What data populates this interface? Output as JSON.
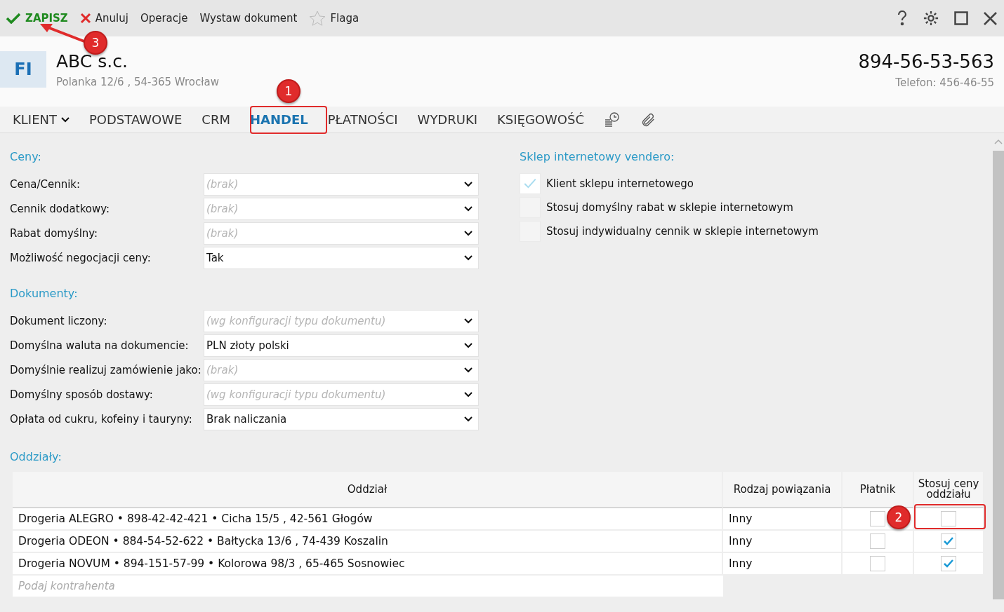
{
  "toolbar": {
    "actions": [
      {
        "kind": "save",
        "label": "ZAPISZ"
      },
      {
        "kind": "cancel",
        "label": "Anuluj"
      },
      {
        "kind": "plain",
        "label": "Operacje"
      },
      {
        "kind": "plain",
        "label": "Wystaw dokument"
      },
      {
        "kind": "flag",
        "label": "Flaga"
      }
    ]
  },
  "header": {
    "avatar": "FI",
    "name": "ABC s.c.",
    "address": "Polanka  12/6 , 54-365 Wrocław",
    "tax_id": "894-56-53-563",
    "phone": "Telefon: 456-46-55"
  },
  "tabs": [
    {
      "label": "KLIENT",
      "kind": "menu",
      "selected": false
    },
    {
      "label": "PODSTAWOWE",
      "kind": "text",
      "selected": false
    },
    {
      "label": "CRM",
      "kind": "text",
      "selected": false
    },
    {
      "label": "HANDEL",
      "kind": "text",
      "selected": true
    },
    {
      "label": "PŁATNOŚCI",
      "kind": "text",
      "selected": false
    },
    {
      "label": "WYDRUKI",
      "kind": "text",
      "selected": false
    },
    {
      "label": "KSIĘGOWOŚĆ",
      "kind": "text",
      "selected": false
    },
    {
      "kind": "history",
      "selected": false
    },
    {
      "kind": "attachment",
      "selected": false
    }
  ],
  "sections": [
    {
      "title": "Ceny:",
      "fields": [
        {
          "label": "Cena/Cennik:",
          "placeholder": "(brak)"
        },
        {
          "label": "Cennik dodatkowy:",
          "placeholder": "(brak)"
        },
        {
          "label": "Rabat domyślny:",
          "placeholder": "(brak)"
        },
        {
          "label": "Możliwość negocjacji ceny:",
          "value": "Tak"
        }
      ]
    },
    {
      "title": "Dokumenty:",
      "fields": [
        {
          "label": "Dokument liczony:",
          "placeholder": "(wg konfiguracji typu dokumentu)"
        },
        {
          "label": "Domyślna waluta na dokumencie:",
          "value": "PLN  złoty polski"
        },
        {
          "label": "Domyślnie realizuj zamówienie jako:",
          "placeholder": "(brak)"
        },
        {
          "label": "Domyślny sposób dostawy:",
          "placeholder": "(wg konfiguracji typu dokumentu)"
        },
        {
          "label": "Opłata od cukru, kofeiny i tauryny:",
          "value": "Brak naliczania"
        }
      ]
    }
  ],
  "shop": {
    "title": "Sklep internetowy vendero:",
    "options": [
      {
        "label": "Klient sklepu internetowego",
        "checked": true
      },
      {
        "label": "Stosuj domyślny rabat w sklepie internetowym",
        "checked": false
      },
      {
        "label": "Stosuj indywidualny cennik w sklepie internetowym",
        "checked": false
      }
    ]
  },
  "branches": {
    "title": "Oddziały:",
    "columns": [
      "Oddział",
      "Rodzaj powiązania",
      "Płatnik",
      "Stosuj ceny oddziału"
    ],
    "rows": [
      {
        "branch": "Drogeria ALEGRO • 898-42-42-421 • Cicha  15/5 , 42-561 Głogów",
        "relation": "Inny",
        "payer": false,
        "use_prices": false
      },
      {
        "branch": "Drogeria ODEON • 884-54-52-622 • Bałtycka  13/6 , 74-439 Koszalin",
        "relation": "Inny",
        "payer": false,
        "use_prices": true
      },
      {
        "branch": "Drogeria NOVUM • 894-151-57-99 • Kolorowa  98/3 , 65-465 Sosnowiec",
        "relation": "Inny",
        "payer": false,
        "use_prices": true
      }
    ],
    "new_row": {
      "placeholder": "Podaj kontrahenta"
    }
  },
  "annotations": [
    {
      "number": "1"
    },
    {
      "number": "2"
    },
    {
      "number": "3"
    }
  ]
}
